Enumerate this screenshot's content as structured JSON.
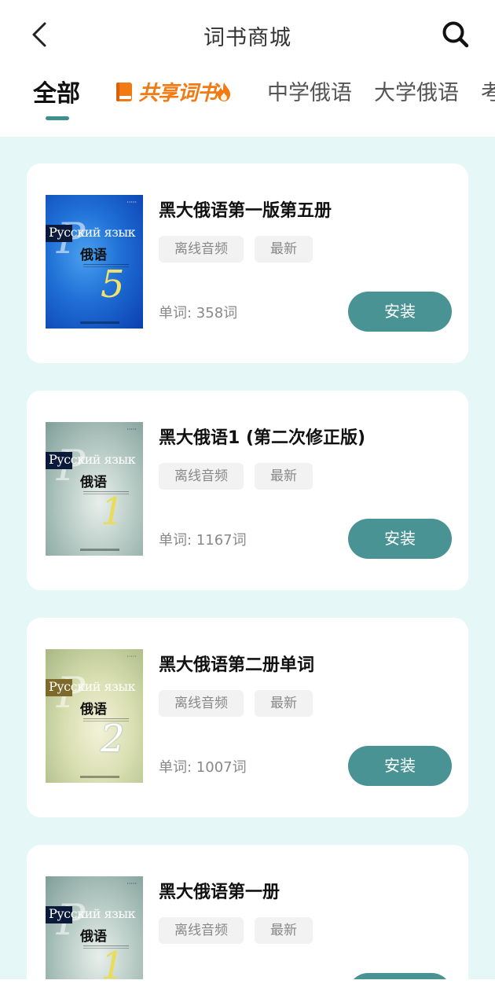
{
  "header": {
    "title": "词书商城"
  },
  "tabs": [
    {
      "label": "全部",
      "active": true
    },
    {
      "label": "共享词书",
      "special": true
    },
    {
      "label": "中学俄语"
    },
    {
      "label": "大学俄语"
    },
    {
      "label": "考"
    }
  ],
  "colors": {
    "accent": "#4a9395",
    "shared_tab": "#f27a12",
    "background": "#e6f7f7"
  },
  "books": [
    {
      "name": "黑大俄语第一版第五册",
      "tags": [
        "离线音频",
        "最新"
      ],
      "words": "单词: 358词",
      "button": "安装",
      "cover": {
        "ru": "Русский язык",
        "zh": "俄语",
        "num": "5",
        "theme": "blue"
      }
    },
    {
      "name": "黑大俄语1 (第二次修正版)",
      "tags": [
        "离线音频",
        "最新"
      ],
      "words": "单词: 1167词",
      "button": "安装",
      "cover": {
        "ru": "Русский язык",
        "zh": "俄语",
        "num": "1",
        "theme": "green"
      }
    },
    {
      "name": "黑大俄语第二册单词",
      "tags": [
        "离线音频",
        "最新"
      ],
      "words": "单词: 1007词",
      "button": "安装",
      "cover": {
        "ru": "Русский язык",
        "zh": "俄语",
        "num": "2",
        "theme": "yellow"
      }
    },
    {
      "name": "黑大俄语第一册",
      "tags": [
        "离线音频",
        "最新"
      ],
      "words": "",
      "button": "",
      "cover": {
        "ru": "Русский язык",
        "zh": "俄语",
        "num": "1",
        "theme": "green"
      }
    }
  ]
}
